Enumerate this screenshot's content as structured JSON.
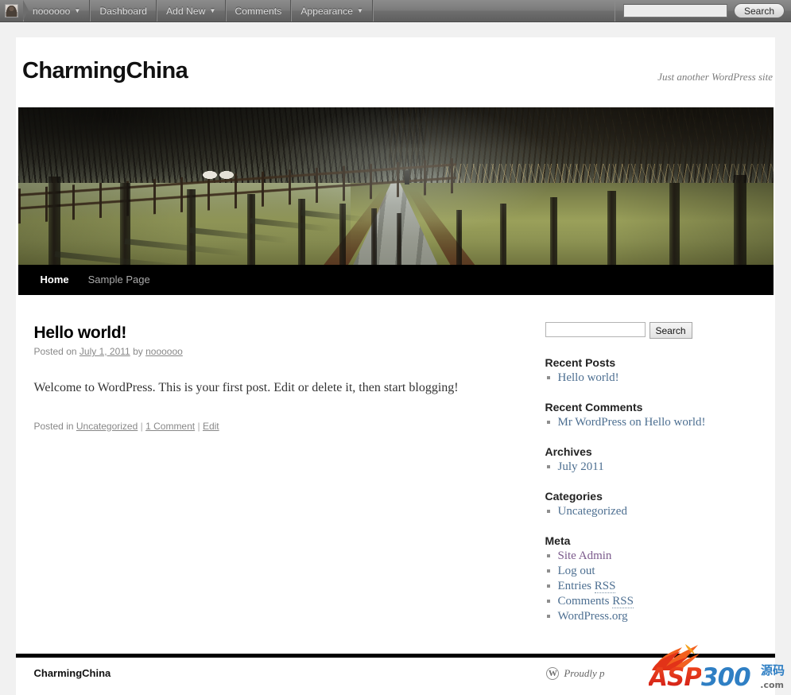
{
  "admin_bar": {
    "avatar_name": "avatar",
    "items": [
      {
        "label": "noooooo",
        "has_menu": true
      },
      {
        "label": "Dashboard",
        "has_menu": false
      },
      {
        "label": "Add New",
        "has_menu": true
      },
      {
        "label": "Comments",
        "has_menu": false
      },
      {
        "label": "Appearance",
        "has_menu": true
      }
    ],
    "search": {
      "value": "",
      "placeholder": "",
      "button_label": "Search"
    }
  },
  "site": {
    "title": "CharmingChina",
    "description": "Just another WordPress site",
    "header_image_alt": "tree-lined lane in winter with gravel path"
  },
  "nav": {
    "items": [
      {
        "label": "Home",
        "current": true
      },
      {
        "label": "Sample Page",
        "current": false
      }
    ]
  },
  "post": {
    "title": "Hello world!",
    "meta_prefix": "Posted on",
    "date": "July 1, 2011",
    "meta_by": "by",
    "author": "noooooo",
    "content": "Welcome to WordPress. This is your first post. Edit or delete it, then start blogging!",
    "utility_prefix": "Posted in",
    "category": "Uncategorized",
    "comments": "1 Comment",
    "edit": "Edit",
    "separator": "|"
  },
  "sidebar": {
    "search": {
      "value": "",
      "placeholder": "",
      "button_label": "Search"
    },
    "widgets": [
      {
        "title": "Recent Posts",
        "items": [
          {
            "text": "Hello world!",
            "link": true
          }
        ]
      },
      {
        "title": "Recent Comments",
        "items": [
          {
            "author": "Mr WordPress",
            "joiner": "on",
            "post": "Hello world!",
            "link": true
          }
        ]
      },
      {
        "title": "Archives",
        "items": [
          {
            "text": "July 2011",
            "link": true
          }
        ]
      },
      {
        "title": "Categories",
        "items": [
          {
            "text": "Uncategorized",
            "link": true
          }
        ]
      },
      {
        "title": "Meta",
        "items": [
          {
            "text": "Site Admin",
            "link": true,
            "visited": true
          },
          {
            "text": "Log out",
            "link": true
          },
          {
            "text": "Entries ",
            "abbr": "RSS",
            "link": true
          },
          {
            "text": "Comments ",
            "abbr": "RSS",
            "link": true
          },
          {
            "text": "WordPress.org",
            "link": true
          }
        ]
      }
    ]
  },
  "footer": {
    "site_info": "CharmingChina",
    "generator": "Proudly p",
    "wp_mark": "W"
  },
  "watermark": {
    "asp": "ASP",
    "num": "300",
    "cn": "源码",
    "dotcom": ".com"
  },
  "colors": {
    "admin_bar": "#6e6e6e",
    "nav_bar": "#000000",
    "link": "#4d6f91",
    "visited_link": "#7b5a8c",
    "meta_text": "#888888",
    "page_bg": "#f1f1f1",
    "watermark_red": "#f04a1e",
    "watermark_blue": "#2f7fc4"
  }
}
